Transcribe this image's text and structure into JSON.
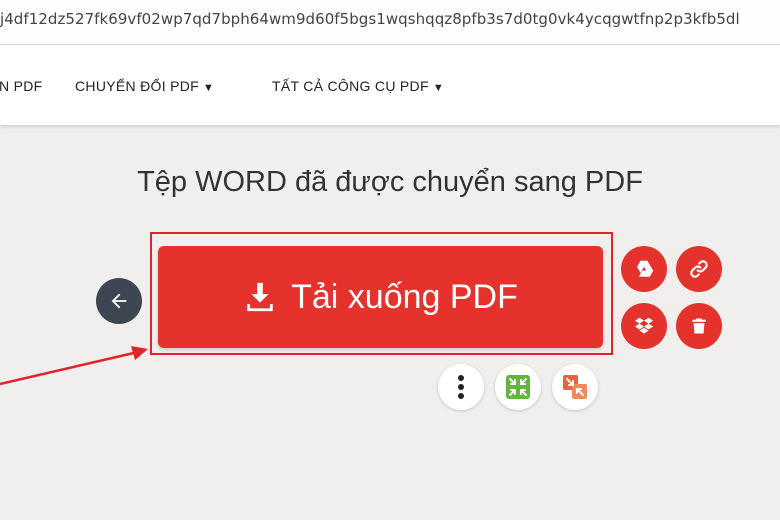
{
  "browser": {
    "url": "j4df12dz527fk69vf02wp7qd7bph64wm9d60f5bgs1wqshqqz8pfb3s7d0tg0vk4ycqgwtfnp2p3kfb5dl"
  },
  "nav": {
    "item_partial": "N PDF",
    "convert_label": "CHUYỂN ĐỔI PDF",
    "all_tools_label": "TẤT CẢ CÔNG CỤ PDF"
  },
  "main": {
    "title": "Tệp WORD đã được chuyển sang PDF",
    "download_label": "Tải xuống PDF"
  },
  "icons": {
    "back": "arrow-left-icon",
    "download": "download-icon",
    "drive": "google-drive-icon",
    "link": "link-icon",
    "dropbox": "dropbox-icon",
    "delete": "trash-icon",
    "more": "more-vertical-icon",
    "compress": "compress-icon",
    "split": "split-icon"
  },
  "colors": {
    "accent": "#e5322d",
    "back_button": "#3e4653",
    "compress": "#64b53e",
    "split": "#e8643c"
  }
}
